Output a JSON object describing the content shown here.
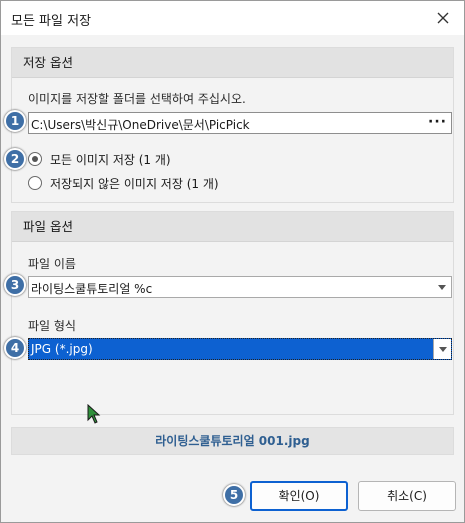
{
  "window": {
    "title": "모든 파일 저장"
  },
  "save_options": {
    "header": "저장 옵션",
    "folder_prompt": "이미지를 저장할 폴더를 선택하여 주십시오.",
    "folder_path": "C:\\Users\\박신규\\OneDrive\\문서\\PicPick",
    "browse_label": "···",
    "radio_all": "모든 이미지 저장 (1 개)",
    "radio_unsaved": "저장되지 않은 이미지 저장 (1 개)",
    "selected_radio": "all"
  },
  "file_options": {
    "header": "파일 옵션",
    "name_label": "파일 이름",
    "name_value": "라이팅스쿨튜토리얼 %c",
    "format_label": "파일 형식",
    "format_value": "JPG (*.jpg)"
  },
  "preview_filename": "라이팅스쿨튜토리얼 001.jpg",
  "buttons": {
    "ok": "확인(O)",
    "cancel": "취소(C)"
  },
  "badges": [
    "1",
    "2",
    "3",
    "4",
    "5"
  ],
  "colors": {
    "accent": "#0d61d1",
    "badge": "#3f6fa6",
    "filename_text": "#2f5f91"
  }
}
